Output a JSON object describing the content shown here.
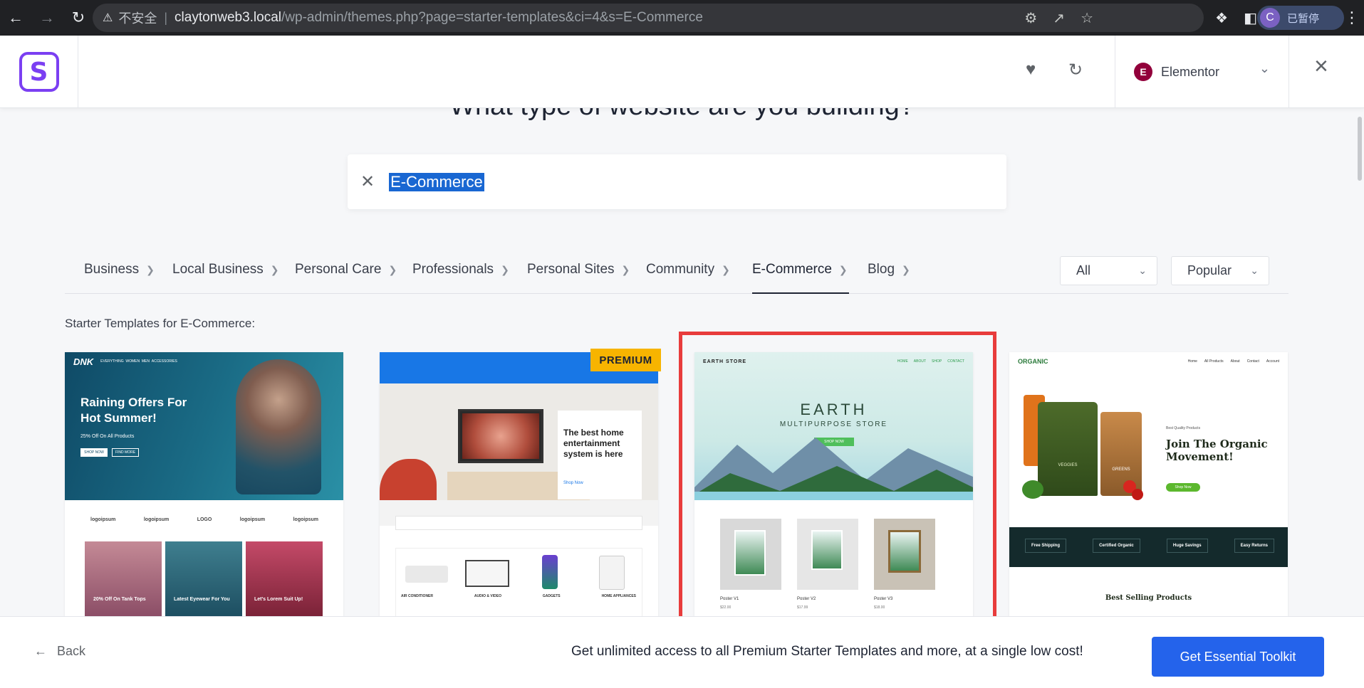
{
  "browser": {
    "insecure_label": "不安全",
    "url_host": "claytonweb3.local",
    "url_path": "/wp-admin/themes.php?page=starter-templates&ci=4&s=E-Commerce",
    "profile_initial": "C",
    "profile_status": "已暂停"
  },
  "header": {
    "logo_letter": "S",
    "builder_initial": "E",
    "builder_label": "Elementor"
  },
  "page": {
    "heading": "What type of website are you building?",
    "search_value": "E-Commerce",
    "subtitle": "Starter Templates for E-Commerce:"
  },
  "categories": [
    {
      "label": "Business"
    },
    {
      "label": "Local Business"
    },
    {
      "label": "Personal Care"
    },
    {
      "label": "Professionals"
    },
    {
      "label": "Personal Sites"
    },
    {
      "label": "Community"
    },
    {
      "label": "E-Commerce",
      "active": true
    },
    {
      "label": "Blog"
    }
  ],
  "filters": {
    "type_value": "All",
    "sort_value": "Popular"
  },
  "templates": [
    {
      "brand": "DNK",
      "hero_title": "Raining Offers For Hot Summer!",
      "hero_sub": "25% Off On All Products",
      "btn1": "SHOP NOW",
      "btn2": "FIND MORE",
      "logos": [
        "logoipsum",
        "logoipsum",
        "LOGO",
        "logoipsum",
        "logoipsum"
      ],
      "tiles": [
        "20% Off On Tank Tops",
        "Latest Eyewear For You",
        "Let's Lorem Suit Up!"
      ]
    },
    {
      "badge": "PREMIUM",
      "hero_title": "The best home entertainment system is here",
      "shop_link": "Shop Now",
      "products": [
        "AIR CONDITIONER",
        "AUDIO & VIDEO",
        "GADGETS",
        "HOME APPLIANCES"
      ]
    },
    {
      "brand": "EARTH STORE",
      "nav": [
        "HOME",
        "ABOUT",
        "SHOP",
        "CONTACT"
      ],
      "hero_title": "EARTH",
      "hero_sub": "MULTIPURPOSE STORE",
      "btn": "SHOP NOW",
      "products": [
        {
          "name": "Poster V1",
          "price": "$22.00"
        },
        {
          "name": "Poster V2",
          "price": "$17.99"
        },
        {
          "name": "Poster V3",
          "price": "$18.00"
        }
      ]
    },
    {
      "brand": "ORGANIC",
      "nav": [
        "Home",
        "All Products",
        "About",
        "Contact",
        "Account"
      ],
      "eyebrow": "Best Quality Products",
      "hero_title": "Join The Organic Movement!",
      "btn": "Shop Now",
      "bag_label_1": "VEGGIES",
      "bag_label_2": "GREENS",
      "features": [
        "Free Shipping",
        "Certified Organic",
        "Huge Savings",
        "Easy Returns"
      ],
      "section_title": "Best Selling Products"
    }
  ],
  "footer": {
    "back_label": "Back",
    "promo_text": "Get unlimited access to all Premium Starter Templates and more, at a single low cost!",
    "cta_label": "Get Essential Toolkit"
  }
}
